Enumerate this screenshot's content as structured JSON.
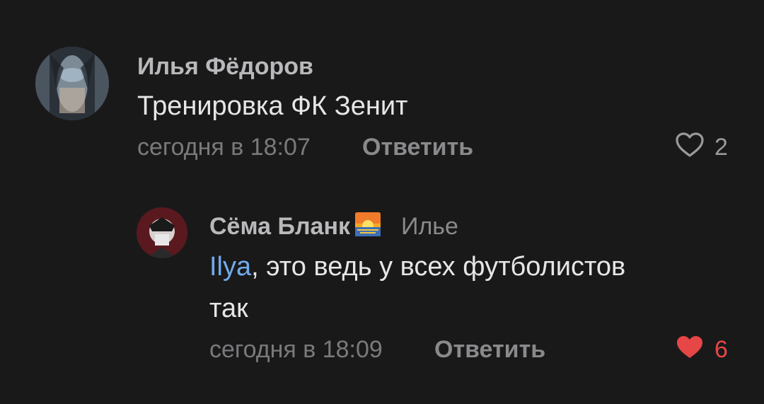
{
  "comments": [
    {
      "author": "Илья Фёдоров",
      "text": "Тренировка ФК Зенит",
      "time": "сегодня в 18:07",
      "reply_label": "Ответить",
      "likes": "2",
      "liked": false
    }
  ],
  "reply": {
    "author": "Сёма Бланк",
    "author_badge": "sunset-emoji",
    "reply_to": "Илье",
    "mention": "Ilya",
    "text_line1": ", это ведь у всех футболистов",
    "text_line2": "так",
    "time": "сегодня в 18:09",
    "reply_label": "Ответить",
    "likes": "6",
    "liked": true
  },
  "colors": {
    "background": "#19191a",
    "mention": "#71aaeb",
    "like_active": "#e64646",
    "like_inactive": "#9a9a9c"
  }
}
